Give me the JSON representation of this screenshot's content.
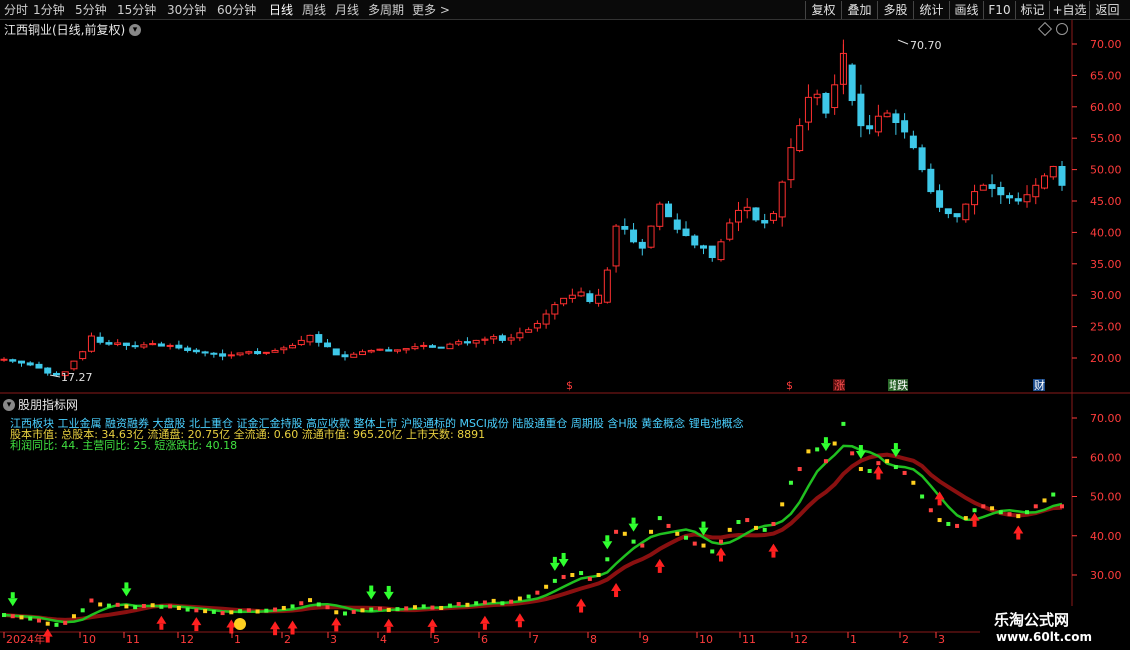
{
  "toolbar": {
    "periods": [
      "分时",
      "1分钟",
      "5分钟",
      "15分钟",
      "30分钟",
      "60分钟",
      "日线",
      "周线",
      "月线",
      "多周期",
      "更多 >"
    ],
    "active_period": "日线",
    "right_buttons": [
      "复权",
      "叠加",
      "多股",
      "统计",
      "画线",
      "F10",
      "标记",
      "+自选",
      "返回"
    ]
  },
  "main_chart": {
    "title": "江西铜业(日线,前复权)",
    "high_label": "70.70",
    "low_label": "17.27",
    "yaxis_labels": [
      "70.00",
      "65.00",
      "60.00",
      "55.00",
      "50.00",
      "45.00",
      "40.00",
      "35.00",
      "30.00",
      "25.00",
      "20.00"
    ],
    "markers": [
      {
        "text": "$",
        "color": "#ff3c3c",
        "bg": ""
      },
      {
        "text": "$",
        "color": "#ff3c3c",
        "bg": ""
      },
      {
        "text": "涨",
        "color": "#ff5050",
        "bg": "#5a1010"
      },
      {
        "text": "增",
        "color": "#ffffff",
        "bg": "#2a6a2a"
      },
      {
        "text": "跌",
        "color": "#ffffff",
        "bg": "#2a5a2a"
      },
      {
        "text": "财",
        "color": "#ffffff",
        "bg": "#1a4a8a"
      }
    ]
  },
  "indicator": {
    "title": "股朋指标网",
    "line1": "江西板块 工业金属 融资融券 大盘股 北上重仓 证金汇金持股 高应收款 整体上市 沪股通标的 MSCI成份 陆股通重仓 周期股 含H股 黄金概念 锂电池概念",
    "line2": "股本市值: 总股本: 34.63亿 流通盘: 20.75亿 全流通: 0.60 流通市值: 965.20亿 上市天数: 8891",
    "line3": "利润同比: 44. 主营同比: 25. 短涨跌比: 40.18",
    "yaxis_labels": [
      "70.00",
      "60.00",
      "50.00",
      "40.00",
      "30.00"
    ]
  },
  "xaxis": {
    "labels": [
      "2024年",
      "10",
      "11",
      "12",
      "1",
      "2",
      "3",
      "4",
      "5",
      "6",
      "7",
      "8",
      "9",
      "10",
      "11",
      "12",
      "1",
      "2",
      "3"
    ]
  },
  "watermark": {
    "line1": "乐淘公式网",
    "line2": "www.60lt.com"
  },
  "chart_data": {
    "type": "candlestick",
    "title": "江西铜业(日线,前复权)",
    "ylim": [
      15,
      73
    ],
    "yticks": [
      20,
      25,
      30,
      35,
      40,
      45,
      50,
      55,
      60,
      65,
      70
    ],
    "month_labels": [
      "2024年",
      "10",
      "11",
      "12",
      "1",
      "2",
      "3",
      "4",
      "5",
      "6",
      "7",
      "8",
      "9",
      "10",
      "11",
      "12",
      "1",
      "2",
      "3"
    ],
    "close_series": [
      19.8,
      19.5,
      19.2,
      18.9,
      18.4,
      17.6,
      17.3,
      17.8,
      19.5,
      21.0,
      23.5,
      22.5,
      22.2,
      22.4,
      22.0,
      21.8,
      22.1,
      22.3,
      21.9,
      22.0,
      21.6,
      21.2,
      21.0,
      20.8,
      20.6,
      20.3,
      20.5,
      20.8,
      21.0,
      20.7,
      20.9,
      21.2,
      21.6,
      22.0,
      22.8,
      23.6,
      22.5,
      21.8,
      20.5,
      20.2,
      20.6,
      21.0,
      21.2,
      21.4,
      21.1,
      21.3,
      21.5,
      21.8,
      22.0,
      21.7,
      21.6,
      22.2,
      22.6,
      22.4,
      22.8,
      23.0,
      23.4,
      22.8,
      23.2,
      24.0,
      24.5,
      25.5,
      27.0,
      28.5,
      29.5,
      30.0,
      30.5,
      29.0,
      30.0,
      34.0,
      41.0,
      40.5,
      38.5,
      37.5,
      41.0,
      44.5,
      42.5,
      40.5,
      39.5,
      38.0,
      37.5,
      36.0,
      38.5,
      41.5,
      43.5,
      44.0,
      42.0,
      41.5,
      43.0,
      48.0,
      53.5,
      57.0,
      61.5,
      62.0,
      59.0,
      63.5,
      68.5,
      61.0,
      57.0,
      56.5,
      58.5,
      59.0,
      57.5,
      56.0,
      53.5,
      50.0,
      46.5,
      44.0,
      43.0,
      42.5,
      44.5,
      46.5,
      47.5,
      47.0,
      46.0,
      45.5,
      45.0,
      46.0,
      47.5,
      49.0,
      50.5,
      47.5
    ],
    "high": 70.7,
    "low": 17.27
  }
}
